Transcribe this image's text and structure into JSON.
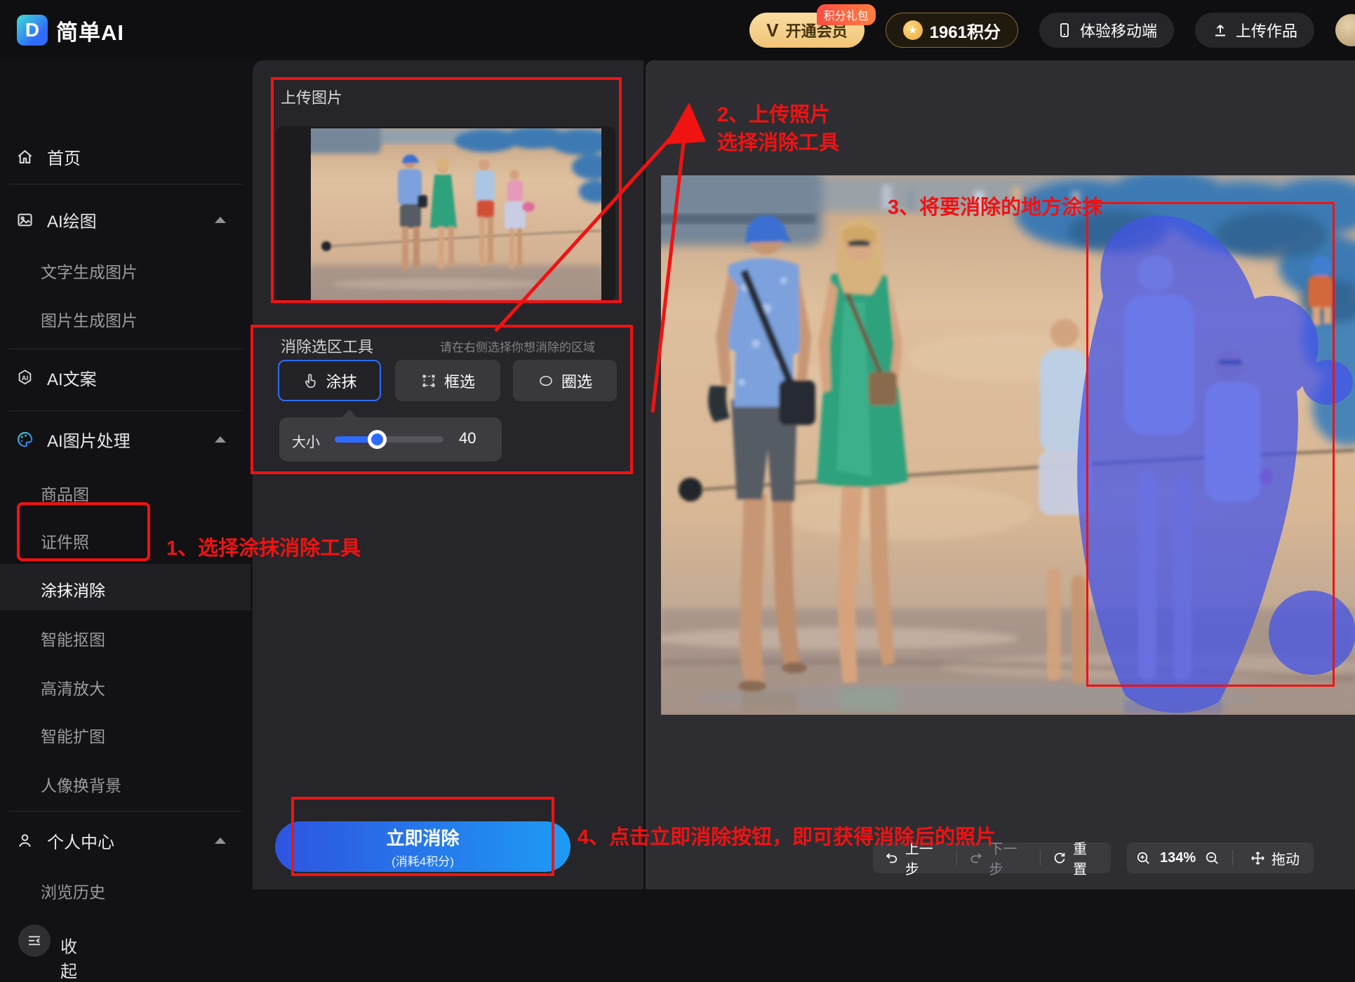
{
  "header": {
    "logo": "简单AI",
    "vip": "开通会员",
    "vip_badge": "积分礼包",
    "points": "1961积分",
    "mobile": "体验移动端",
    "upload_work": "上传作品"
  },
  "sidebar": {
    "home": "首页",
    "ai_draw": "AI绘图",
    "text_to_image": "文字生成图片",
    "image_to_image": "图片生成图片",
    "ai_copywriting": "AI文案",
    "ai_image": "AI图片处理",
    "product_image": "商品图",
    "id_photo": "证件照",
    "smear_erase": "涂抹消除",
    "smart_matting": "智能抠图",
    "hd_upscale": "高清放大",
    "smart_expand": "智能扩图",
    "portrait_bg": "人像换背景",
    "personal_center": "个人中心",
    "browse_history": "浏览历史",
    "collapse": "收起"
  },
  "erase_panel": {
    "upload_title": "上传图片",
    "tools_title": "消除选区工具",
    "tools_hint": "请在右侧选择你想消除的区域",
    "tool_smear": "涂抹",
    "tool_box": "框选",
    "tool_circle": "圈选",
    "size_label": "大小",
    "size_value": "40",
    "submit": "立即消除",
    "submit_cost": "(消耗4积分)"
  },
  "annotations": {
    "step1": "1、选择涂抹消除工具",
    "step2_line1": "2、上传照片",
    "step2_line2": "选择消除工具",
    "step3": "3、将要消除的地方涂抹",
    "step4": "4、点击立即消除按钮，即可获得消除后的照片"
  },
  "canvas_toolbar": {
    "undo": "上一步",
    "redo": "下一步",
    "reset": "重置",
    "zoom_level": "134%",
    "drag": "拖动"
  },
  "colors": {
    "accent_blue": "#2F6BFF",
    "annotation_red": "#F11212",
    "vip_gold": "#F4C877",
    "mask_blue": "#4453E8"
  }
}
